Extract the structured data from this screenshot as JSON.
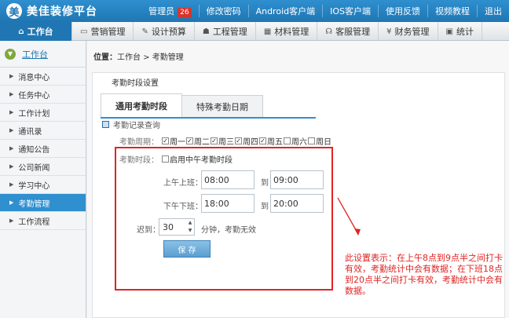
{
  "header": {
    "logo_glyph": "美",
    "brand": "美佳装修平台",
    "links": [
      {
        "label": "管理员",
        "badge": "26"
      },
      {
        "label": "修改密码"
      },
      {
        "label": "Android客户端"
      },
      {
        "label": "IOS客户端"
      },
      {
        "label": "使用反馈"
      },
      {
        "label": "视频教程"
      },
      {
        "label": "退出"
      }
    ]
  },
  "nav": {
    "tabs": [
      {
        "icon": "⌂",
        "label": "工作台"
      },
      {
        "icon": "▭",
        "label": "营销管理"
      },
      {
        "icon": "✎",
        "label": "设计预算"
      },
      {
        "icon": "☗",
        "label": "工程管理"
      },
      {
        "icon": "▦",
        "label": "材料管理"
      },
      {
        "icon": "☊",
        "label": "客服管理"
      },
      {
        "icon": "¥",
        "label": "财务管理"
      },
      {
        "icon": "▣",
        "label": "统计"
      }
    ]
  },
  "sidebar": {
    "title": "工作台",
    "items": [
      "消息中心",
      "任务中心",
      "工作计划",
      "通讯录",
      "通知公告",
      "公司新闻",
      "学习中心",
      "考勤管理",
      "工作流程"
    ]
  },
  "breadcrumb": {
    "prefix": "位置：",
    "path": "工作台  >  考勤管理"
  },
  "panel": {
    "title": "考勤时段设置",
    "tabs": [
      "通用考勤时段",
      "特殊考勤日期"
    ],
    "section": "考勤记录查询",
    "week_label": "考勤周期：",
    "days": [
      {
        "label": "周一",
        "checked": true
      },
      {
        "label": "周二",
        "checked": true
      },
      {
        "label": "周三",
        "checked": true
      },
      {
        "label": "周四",
        "checked": true
      },
      {
        "label": "周五",
        "checked": true
      },
      {
        "label": "周六",
        "checked": false
      },
      {
        "label": "周日",
        "checked": false
      }
    ],
    "period_label": "考勤时段：",
    "noon_option": "启用中午考勤时段",
    "morning_label": "上午上班：",
    "morning_start": "08:00",
    "to": "到",
    "morning_end": "09:00",
    "afternoon_label": "下午下班：",
    "afternoon_start": "18:00",
    "afternoon_end": "20:00",
    "late_label": "迟到：",
    "late_value": "30",
    "late_tail": "分钟，考勤无效",
    "save": "保 存"
  },
  "note": "此设置表示：在上午8点到9点半之间打卡有效，考勤统计中会有数据；在下班18点到20点半之间打卡有效，考勤统计中会有数据。",
  "colors": {
    "primary": "#1f76b3",
    "highlight": "#e02424"
  }
}
